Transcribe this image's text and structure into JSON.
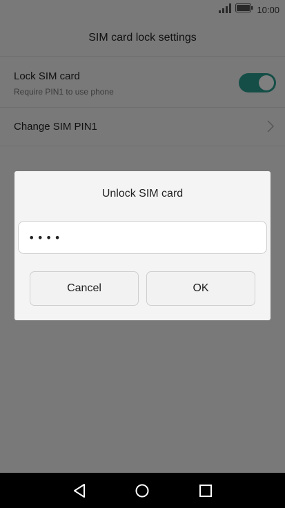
{
  "status_bar": {
    "time": "10:00",
    "icons": [
      "signal-icon",
      "battery-icon"
    ]
  },
  "header": {
    "title": "SIM card lock settings"
  },
  "settings": {
    "lock_sim": {
      "title": "Lock SIM card",
      "subtitle": "Require PIN1 to use phone",
      "toggle_on": true,
      "toggle_color": "#2a9d8f"
    },
    "change_pin": {
      "title": "Change SIM PIN1",
      "icon": "chevron-right-icon"
    }
  },
  "dialog": {
    "title": "Unlock SIM card",
    "pin_value": "••••",
    "cancel_label": "Cancel",
    "ok_label": "OK"
  },
  "nav_bar": {
    "icons": [
      "back-icon",
      "home-icon",
      "recent-apps-icon"
    ]
  }
}
